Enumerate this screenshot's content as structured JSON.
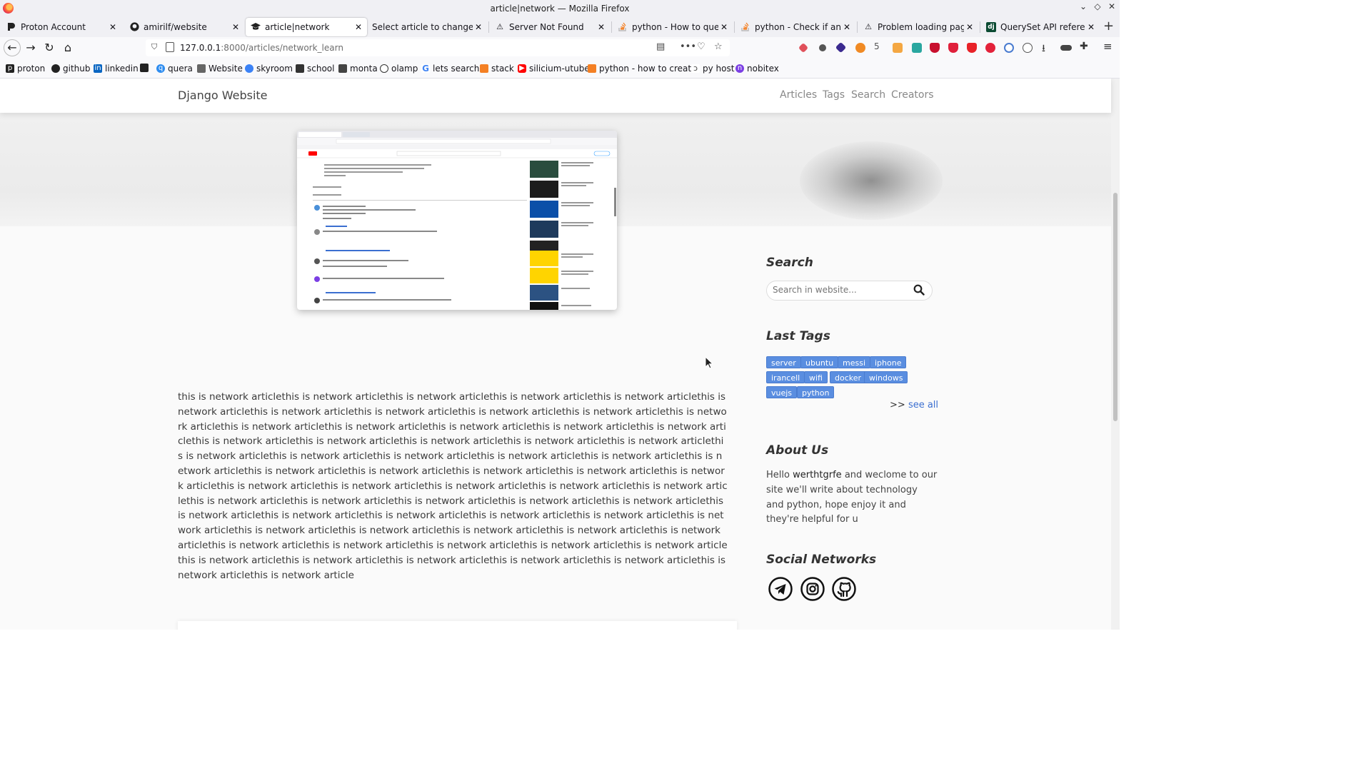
{
  "window": {
    "title": "article|network — Mozilla Firefox"
  },
  "tabs": [
    {
      "label": "Proton Account",
      "icon": "proton-icon",
      "active": false
    },
    {
      "label": "amirilf/website",
      "icon": "github-icon",
      "active": false
    },
    {
      "label": "article|network",
      "icon": "graduation-cap-icon",
      "active": true
    },
    {
      "label": "Select article to change | D",
      "icon": "none",
      "active": false
    },
    {
      "label": "Server Not Found",
      "icon": "warning-icon",
      "active": false
    },
    {
      "label": "python - How to query D",
      "icon": "stackoverflow-icon",
      "active": false
    },
    {
      "label": "python - Check if an obj",
      "icon": "stackoverflow-icon",
      "active": false
    },
    {
      "label": "Problem loading page",
      "icon": "warning-icon",
      "active": false
    },
    {
      "label": "QuerySet API reference",
      "icon": "django-icon",
      "active": false
    }
  ],
  "urlbar": {
    "host": "127.0.0.1",
    "rest": ":8000/articles/network_learn"
  },
  "bookmarks": [
    {
      "label": "proton",
      "icon": "proton-icon"
    },
    {
      "label": "github",
      "icon": "github-icon"
    },
    {
      "label": "linkedin",
      "icon": "linkedin-icon"
    },
    {
      "label": "",
      "icon": "graduation-cap-icon"
    },
    {
      "label": "quera",
      "icon": "quera-icon"
    },
    {
      "label": "Website",
      "icon": "website-icon"
    },
    {
      "label": "skyroom",
      "icon": "skyroom-icon"
    },
    {
      "label": "school",
      "icon": "school-icon"
    },
    {
      "label": "monta",
      "icon": "monta-icon"
    },
    {
      "label": "olamp",
      "icon": "globe-icon"
    },
    {
      "label": "lets search",
      "icon": "google-icon"
    },
    {
      "label": "stack",
      "icon": "stackoverflow-icon"
    },
    {
      "label": "silicium-utube",
      "icon": "youtube-icon"
    },
    {
      "label": "python - how to creat...",
      "icon": "stackoverflow-icon"
    },
    {
      "label": "py host",
      "icon": "pyhost-icon"
    },
    {
      "label": "nobitex",
      "icon": "nobitex-icon"
    }
  ],
  "site": {
    "brand": "Django Website",
    "nav": [
      "Articles",
      "Tags",
      "Search",
      "Creators"
    ]
  },
  "article": {
    "body": "this is network articlethis is network articlethis is network articlethis is network articlethis is network articlethis is network articlethis is network articlethis is network articlethis is network articlethis is network articlethis is network articlethis is network articlethis is network articlethis is network articlethis is network articlethis is network articlethis is network articlethis is network articlethis is network articlethis is network articlethis is network articlethis is network articlethis is network articlethis is network articlethis is network articlethis is network articlethis is network articlethis is network articlethis is network articlethis is network articlethis is network articlethis is network articlethis is network articlethis is network articlethis is network articlethis is network articlethis is network articlethis is network articlethis is network articlethis is network articlethis is network articlethis is network articlethis is network articlethis is network articlethis is network articlethis is network articlethis is network articlethis is network articlethis is network articlethis is network articlethis is network articlethis is network articlethis is network articlethis is network articlethis is network articlethis is network articlethis is network articlethis is network articlethis is network articlethis is network articlethis is network articlethis is network articlethis is network articlethis is network articlethis is network article"
  },
  "sidebar": {
    "search_title": "Search",
    "search_placeholder": "Search in website...",
    "tags_title": "Last Tags",
    "tags": [
      "server",
      "ubuntu",
      "messi",
      "iphone",
      "irancell",
      "wifi",
      "docker",
      "windows",
      "vuejs",
      "python"
    ],
    "see_all_prefix": ">>",
    "see_all": "see all",
    "about_title": "About Us",
    "about_hello": "Hello",
    "about_name": "werthtgrfe",
    "about_text": "and weclome to our site we'll write about technology and python, hope enjoy it and they're helpful for u",
    "social_title": "Social Networks",
    "social": [
      "telegram-icon",
      "instagram-icon",
      "github-icon"
    ]
  },
  "colors": {
    "tag_bg": "#5a8ee0",
    "link": "#3b6fd0"
  }
}
